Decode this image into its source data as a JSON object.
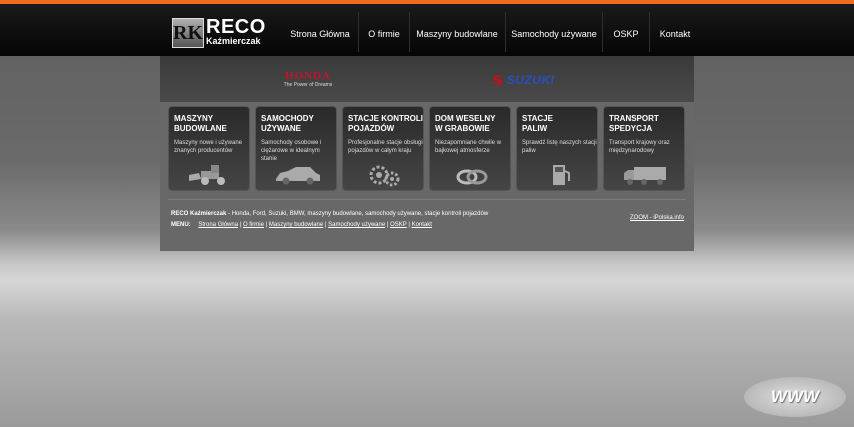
{
  "logo": {
    "mark": "RK",
    "title": "RECO",
    "subtitle": "Kaźmierczak"
  },
  "nav": [
    {
      "label": "Strona Główna"
    },
    {
      "label": "O firmie"
    },
    {
      "label": "Maszyny budowlane"
    },
    {
      "label": "Samochody używane"
    },
    {
      "label": "OSKP"
    },
    {
      "label": "Kontakt"
    }
  ],
  "brands": {
    "honda": {
      "name": "HONDA",
      "tagline": "The Power of Dreams"
    },
    "suzuki": {
      "mark": "S",
      "name": "SUZUKI"
    }
  },
  "tiles": [
    {
      "title": "MASZYNY\nBUDOWLANE",
      "desc": "Maszyny nowe i używane znanych producentów",
      "icon": "loader-icon"
    },
    {
      "title": "SAMOCHODY\nUŻYWANE",
      "desc": "Samochody osobowe i ciężarowe w idealnym stanie",
      "icon": "car-icon"
    },
    {
      "title": "STACJE KONTROLI\nPOJAZDÓW",
      "desc": "Profesjonalne stacje obsługi pojazdów w całym kraju",
      "icon": "gears-icon"
    },
    {
      "title": "DOM WESELNY\nW GRABOWIE",
      "desc": "Niezapomniane chwile w bajkowej atmosferze",
      "icon": "rings-icon"
    },
    {
      "title": "STACJE\nPALIW",
      "desc": "Sprawdź listę naszych stacji paliw",
      "icon": "fuel-pump-icon"
    },
    {
      "title": "TRANSPORT\nSPEDYCJA",
      "desc": "Transport krajowy oraz międzynarodowy",
      "icon": "truck-icon"
    }
  ],
  "footer": {
    "company": "RECO Kaźmierczak",
    "description": " - Honda, Ford, Suzuki, BMW, maszyny budowlane, samochody używane, stacje kontroli pojazdów",
    "menu_label": "MENU:",
    "menu": [
      "Strona Główna",
      "O firmie",
      "Maszyny budowlane",
      "Samochody używane",
      "OSKP",
      "Kontakt"
    ],
    "zoom": "ZOOM - iPolska.info"
  },
  "www_badge": "WWW",
  "colors": {
    "accent": "#f26a1b",
    "honda": "#c8102e",
    "suzuki_s": "#e60012",
    "suzuki_text": "#2a4fbf"
  }
}
